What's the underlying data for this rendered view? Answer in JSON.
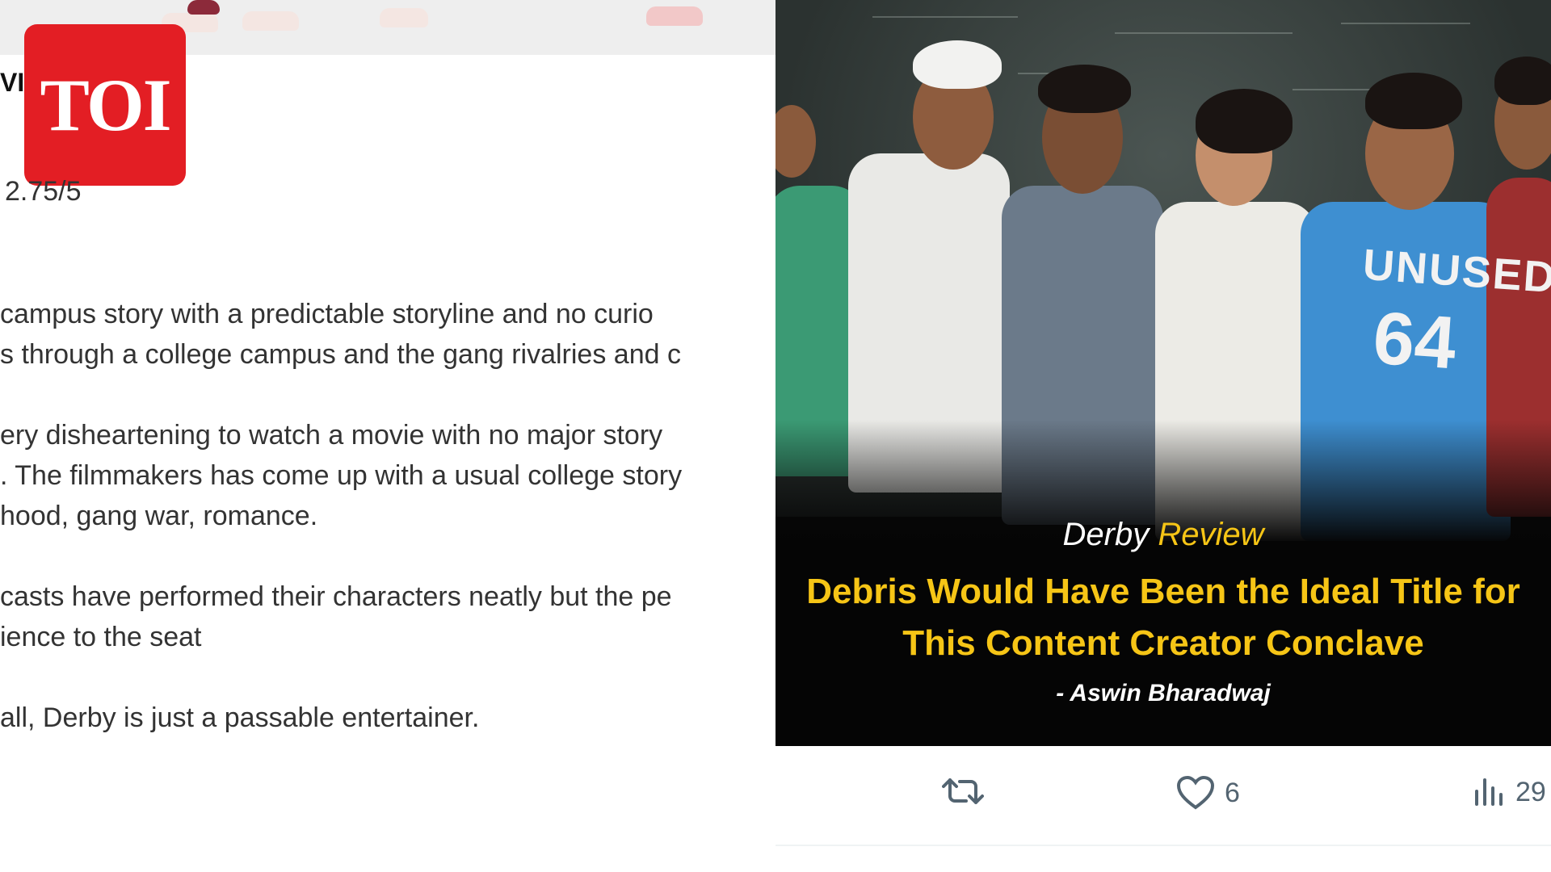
{
  "left": {
    "label_fragment": "VI",
    "rating": "2.75/5",
    "lines": [
      "campus story with a predictable storyline and no curio",
      "s through a college campus and the gang rivalries and c",
      "ery disheartening to watch a movie with no major story",
      ". The filmmakers has come up with a usual college story",
      "hood, gang war, romance.",
      "casts have performed their characters neatly but the pe",
      "ience to the seat",
      "all, Derby is just a passable entertainer."
    ]
  },
  "logo": {
    "text": "TOI",
    "color": "#e31e24"
  },
  "poster": {
    "heading_word1": "Derby",
    "heading_word2": "Review",
    "quote_line1": "Debris Would Have Been the Ideal Title for",
    "quote_line2": "This Content Creator Conclave",
    "author": "-  Aswin Bharadwaj",
    "jersey_text": "UNUSED",
    "jersey_number": "64",
    "accent": "#f6c516"
  },
  "actions": {
    "retweet_icon": "retweet-icon",
    "like_icon": "heart-icon",
    "like_count": "6",
    "views_icon": "bar-chart-icon",
    "views_count": "29"
  }
}
